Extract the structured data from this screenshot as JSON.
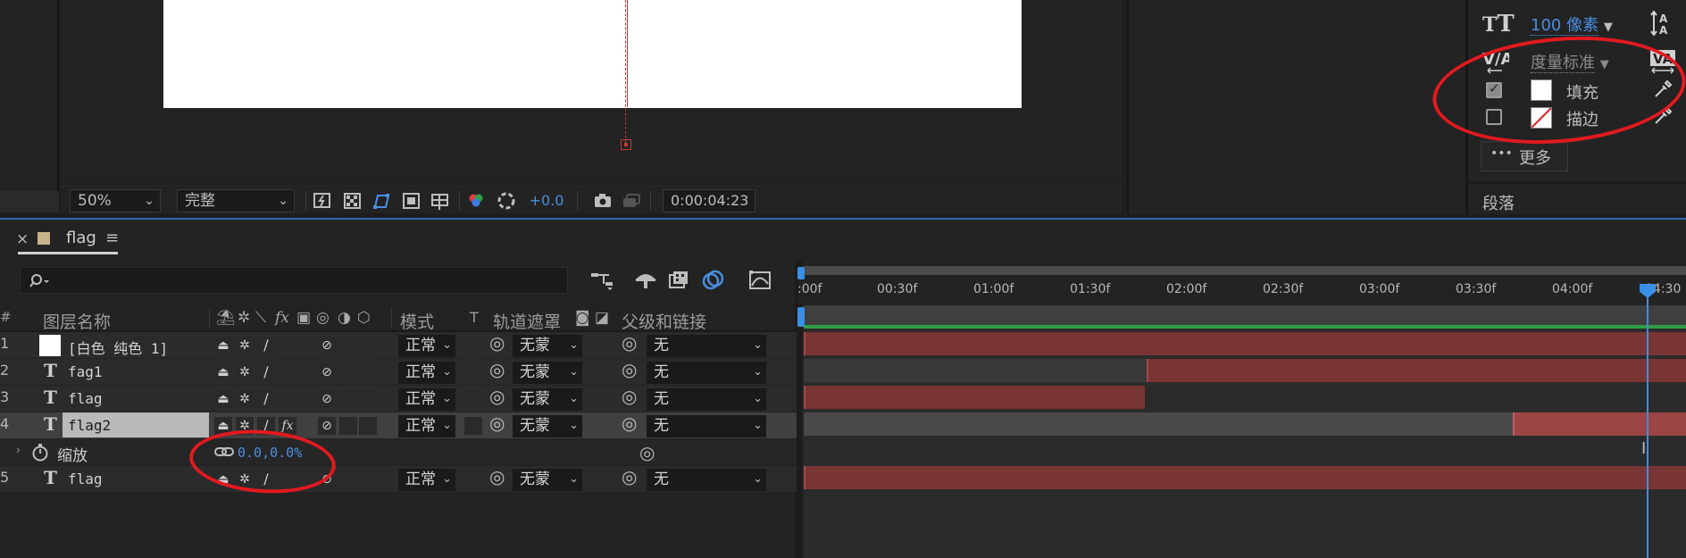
{
  "viewer": {
    "zoom": "50%",
    "resolution": "完整",
    "exposure": "+0.0",
    "timecode": "0:00:04:23"
  },
  "character": {
    "font_size": "100 像素",
    "font_size_arrow": "▼",
    "tracking": "度量标准",
    "tracking_arrow": "▼",
    "fill_label": "填充",
    "stroke_label": "描边",
    "more_dots": "•••",
    "more_label": "更多",
    "paragraph_cut": "段落"
  },
  "timeline": {
    "tab_close": "×",
    "comp_name": "flag",
    "tab_menu": "≡",
    "search_placeholder": "",
    "headers": {
      "num": "#",
      "layer_name": "图层名称",
      "mode": "模式",
      "t": "T",
      "track_matte": "轨道遮罩",
      "parent": "父级和链接"
    },
    "ruler": [
      ":00f",
      "00:30f",
      "01:00f",
      "01:30f",
      "02:00f",
      "02:30f",
      "03:00f",
      "03:30f",
      "04:00f",
      "04:30"
    ],
    "layers": [
      {
        "num": "1",
        "type": "solid",
        "name": "[白色 纯色 1]",
        "mode": "正常",
        "matte": "无蒙",
        "parent": "无"
      },
      {
        "num": "2",
        "type": "text",
        "name": "fag1",
        "mode": "正常",
        "matte": "无蒙",
        "parent": "无"
      },
      {
        "num": "3",
        "type": "text",
        "name": "flag",
        "mode": "正常",
        "matte": "无蒙",
        "parent": "无"
      },
      {
        "num": "4",
        "type": "text",
        "name": "flag2",
        "mode": "正常",
        "matte": "无蒙",
        "parent": "无"
      },
      {
        "num": "5",
        "type": "text",
        "name": "flag",
        "mode": "正常",
        "matte": "无蒙",
        "parent": "无"
      }
    ],
    "property": {
      "name": "缩放",
      "value": "0.0,0.0%"
    },
    "layer_icon_text": "T",
    "cti_cursor": "I"
  }
}
